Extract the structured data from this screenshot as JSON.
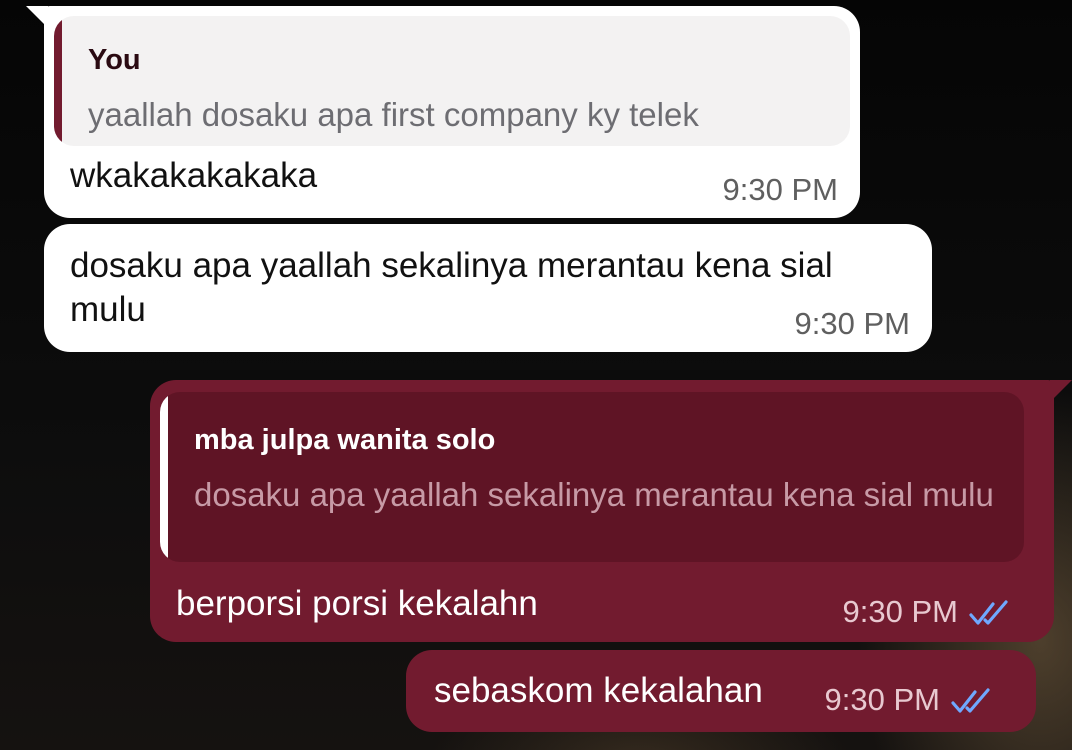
{
  "colors": {
    "outgoing_bubble": "#721b2f",
    "incoming_bubble": "#ffffff",
    "read_ticks": "#6fa8ff"
  },
  "messages": [
    {
      "direction": "incoming",
      "reply": {
        "author": "You",
        "text": "yaallah dosaku apa first company ky telek"
      },
      "text": "wkakakakakaka",
      "time": "9:30 PM"
    },
    {
      "direction": "incoming",
      "text": "dosaku apa yaallah sekalinya merantau kena sial mulu",
      "time": "9:30 PM"
    },
    {
      "direction": "outgoing",
      "reply": {
        "author": "mba julpa wanita solo",
        "text": "dosaku apa yaallah sekalinya merantau kena sial mulu"
      },
      "text": "berporsi porsi kekalahn",
      "time": "9:30 PM",
      "status_icon": "double-check-icon"
    },
    {
      "direction": "outgoing",
      "text": "sebaskom kekalahan",
      "time": "9:30 PM",
      "status_icon": "double-check-icon"
    }
  ]
}
